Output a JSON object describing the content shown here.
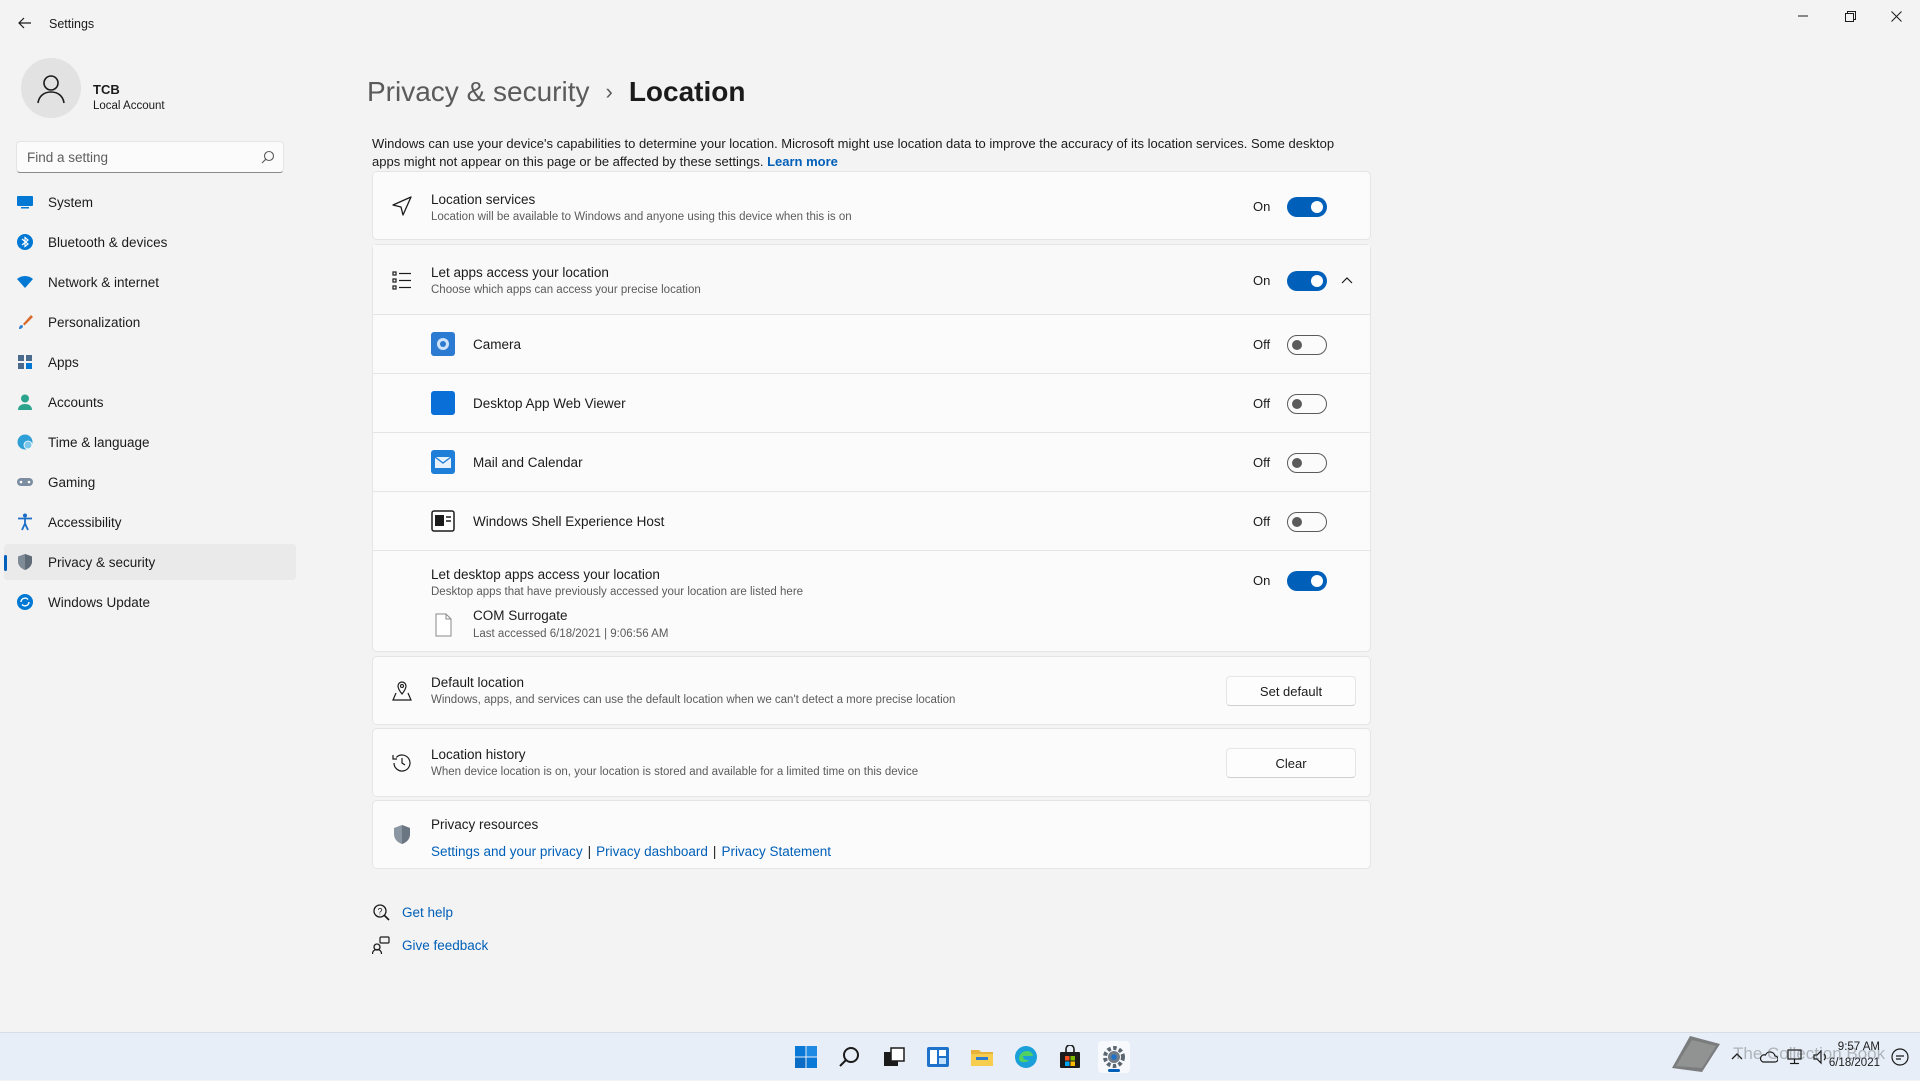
{
  "window": {
    "title": "Settings"
  },
  "profile": {
    "name": "TCB",
    "account_type": "Local Account"
  },
  "search": {
    "placeholder": "Find a setting"
  },
  "sidebar": {
    "items": [
      {
        "label": "System",
        "icon": "system-icon"
      },
      {
        "label": "Bluetooth & devices",
        "icon": "bluetooth-icon"
      },
      {
        "label": "Network & internet",
        "icon": "wifi-icon"
      },
      {
        "label": "Personalization",
        "icon": "brush-icon"
      },
      {
        "label": "Apps",
        "icon": "apps-icon"
      },
      {
        "label": "Accounts",
        "icon": "person-icon"
      },
      {
        "label": "Time & language",
        "icon": "globe-clock-icon"
      },
      {
        "label": "Gaming",
        "icon": "gamepad-icon"
      },
      {
        "label": "Accessibility",
        "icon": "accessibility-icon"
      },
      {
        "label": "Privacy & security",
        "icon": "shield-icon",
        "active": true
      },
      {
        "label": "Windows Update",
        "icon": "update-icon"
      }
    ]
  },
  "header": {
    "parent": "Privacy & security",
    "separator": "›",
    "current": "Location"
  },
  "intro": {
    "text": "Windows can use your device's capabilities to determine your location. Microsoft might use location data to improve the accuracy of its location services. Some desktop apps might not appear on this page or be affected by these settings.",
    "link": "Learn more"
  },
  "location_services": {
    "title": "Location services",
    "subtitle": "Location will be available to Windows and anyone using this device when this is on",
    "state": "On"
  },
  "app_access": {
    "title": "Let apps access your location",
    "subtitle": "Choose which apps can access your precise location",
    "state": "On",
    "apps": [
      {
        "name": "Camera",
        "state": "Off",
        "icon": "camera-app-icon"
      },
      {
        "name": "Desktop App Web Viewer",
        "state": "Off",
        "icon": "web-viewer-app-icon"
      },
      {
        "name": "Mail and Calendar",
        "state": "Off",
        "icon": "mail-app-icon"
      },
      {
        "name": "Windows Shell Experience Host",
        "state": "Off",
        "icon": "shell-host-app-icon"
      }
    ],
    "desktop": {
      "title": "Let desktop apps access your location",
      "subtitle": "Desktop apps that have previously accessed your location are listed here",
      "state": "On",
      "app_name": "COM Surrogate",
      "last_accessed": "Last accessed 6/18/2021  |  9:06:56 AM"
    }
  },
  "default_location": {
    "title": "Default location",
    "subtitle": "Windows, apps, and services can use the default location when we can't detect a more precise location",
    "button": "Set default"
  },
  "location_history": {
    "title": "Location history",
    "subtitle": "When device location is on, your location is stored and available for a limited time on this device",
    "button": "Clear"
  },
  "privacy_resources": {
    "title": "Privacy resources",
    "links": [
      "Settings and your privacy",
      "Privacy dashboard",
      "Privacy Statement"
    ],
    "separator": "|"
  },
  "help": {
    "get_help": "Get help",
    "give_feedback": "Give feedback"
  },
  "taskbar": {
    "time": "9:57 AM",
    "date": "6/18/2021",
    "watermark": "The Collection Book",
    "accent": "#005fb8"
  }
}
